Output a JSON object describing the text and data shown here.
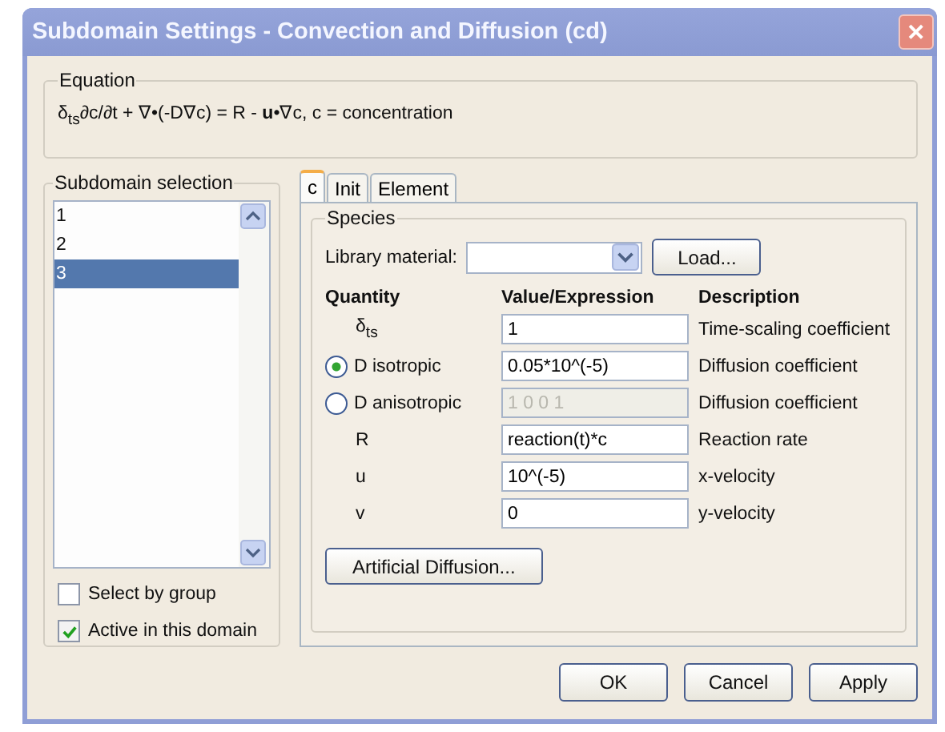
{
  "window": {
    "title": "Subdomain Settings - Convection and Diffusion (cd)",
    "close": "✕"
  },
  "equation": {
    "legend": "Equation",
    "text": "δ$_{ts}$∂c/∂t + ∇•(-D∇c) = R - **u**•∇c, c = concentration"
  },
  "subdomain_selection": {
    "legend": "Subdomain selection",
    "items": [
      {
        "label": "1",
        "selected": false
      },
      {
        "label": "2",
        "selected": false
      },
      {
        "label": "3",
        "selected": true
      }
    ],
    "checkboxes": [
      {
        "label": "Select by group",
        "checked": false
      },
      {
        "label": "Active in this domain",
        "checked": true
      }
    ]
  },
  "tabs": [
    {
      "label": "c",
      "selected": true
    },
    {
      "label": "Init",
      "selected": false
    },
    {
      "label": "Element",
      "selected": false
    }
  ],
  "species": {
    "legend": "Species",
    "library_label": "Library material:",
    "load_button": "Load...",
    "columns": [
      "Quantity",
      "Value/Expression",
      "Description"
    ],
    "rows": [
      {
        "kind": "plain",
        "quantity": "δ$_{ts}$",
        "value": "1",
        "description": "Time-scaling coefficient",
        "disabled": false
      },
      {
        "kind": "radio",
        "selected": true,
        "quantity": "D isotropic",
        "value": "0.05*10^(-5)",
        "description": "Diffusion coefficient",
        "disabled": false
      },
      {
        "kind": "radio",
        "selected": false,
        "quantity": "D anisotropic",
        "value": "1 0 0 1",
        "description": "Diffusion coefficient",
        "disabled": true
      },
      {
        "kind": "plain",
        "quantity": "R",
        "value": "reaction(t)*c",
        "description": "Reaction rate",
        "disabled": false
      },
      {
        "kind": "plain",
        "quantity": "u",
        "value": "10^(-5)",
        "description": "x-velocity",
        "disabled": false
      },
      {
        "kind": "plain",
        "quantity": "v",
        "value": "0",
        "description": "y-velocity",
        "disabled": false
      }
    ],
    "artificial_button": "Artificial Diffusion..."
  },
  "buttons": [
    "OK",
    "Cancel",
    "Apply"
  ]
}
